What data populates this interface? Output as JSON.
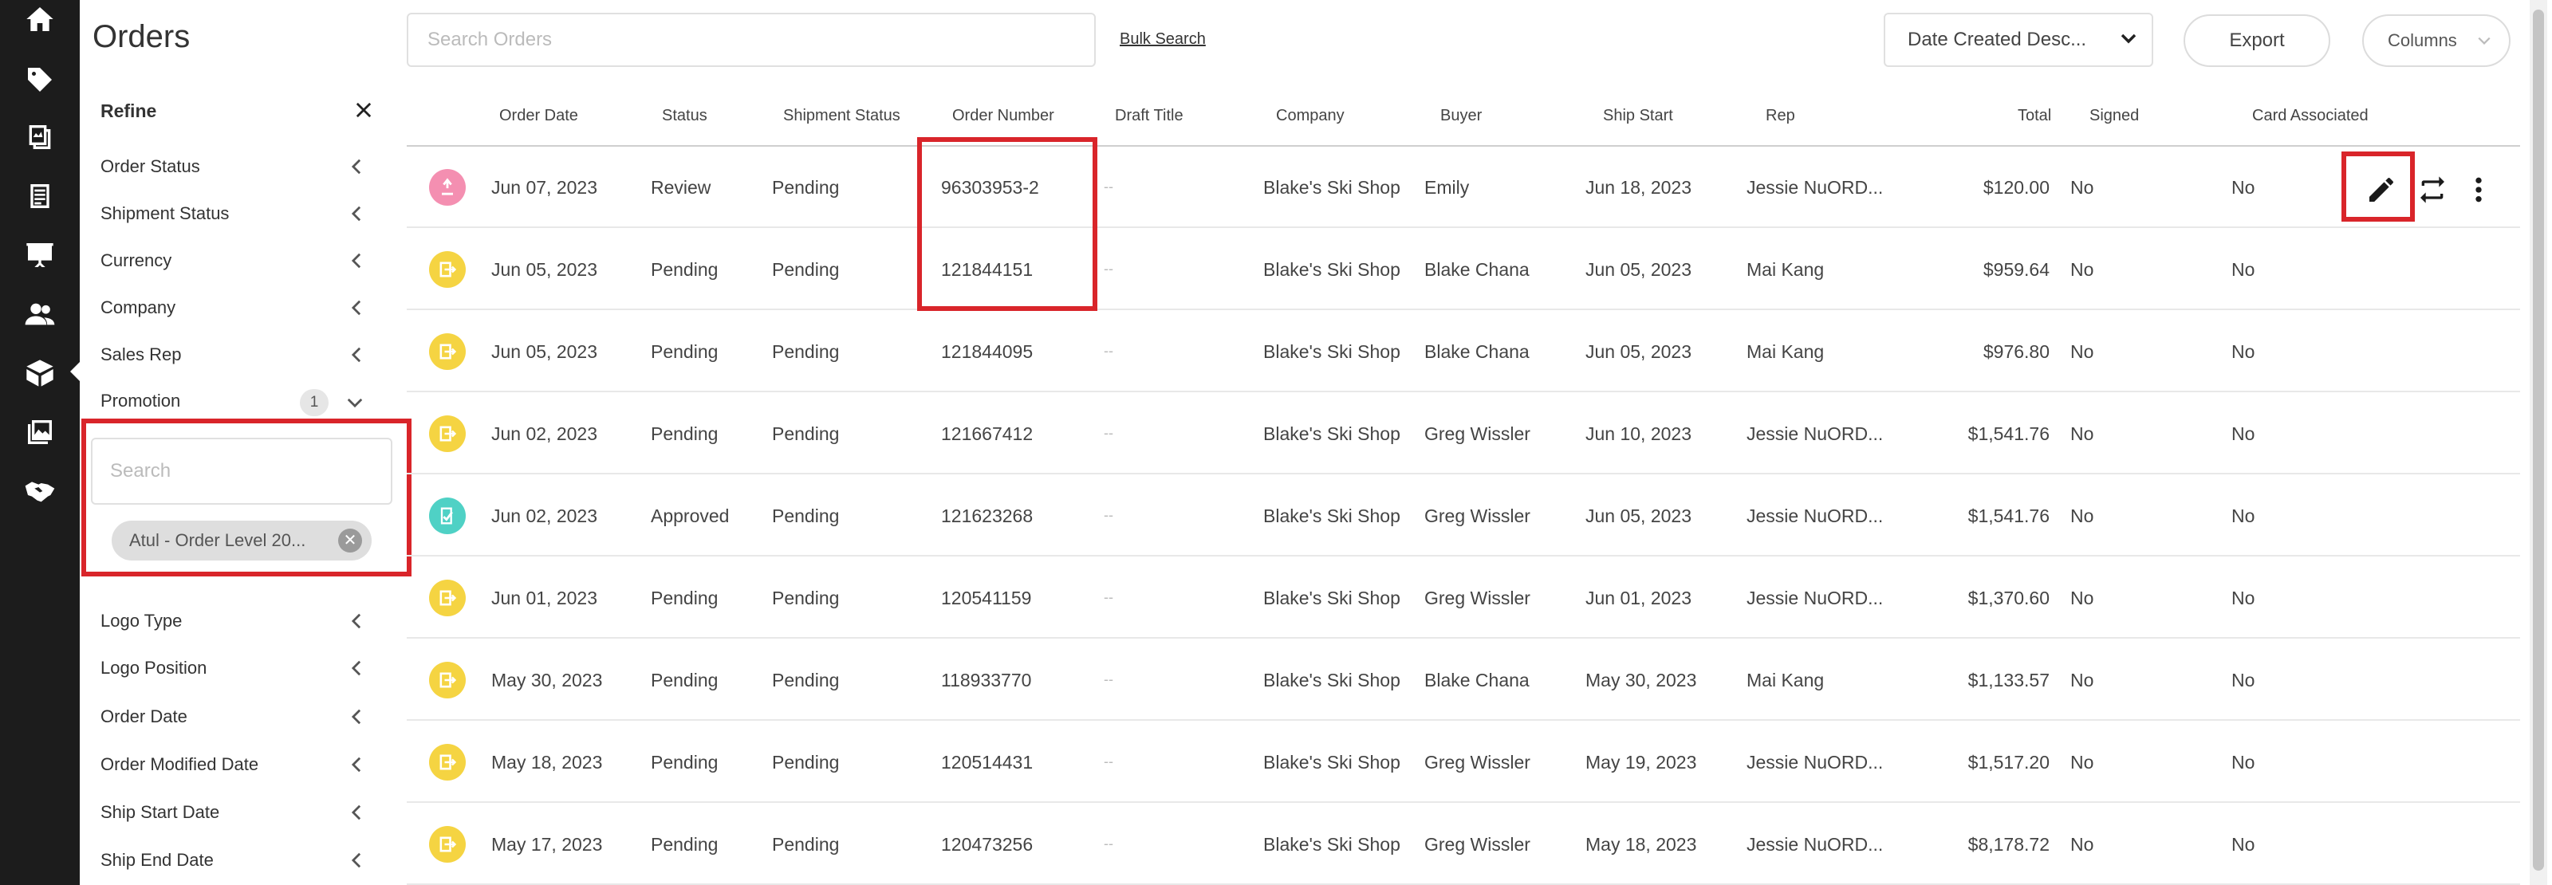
{
  "rail": {
    "icons": [
      "home-icon",
      "tag-icon",
      "catalog-icon",
      "list-icon",
      "presentation-icon",
      "users-icon",
      "box-icon",
      "gallery-icon",
      "handshake-icon"
    ],
    "active_index": 6
  },
  "page": {
    "title": "Orders"
  },
  "refine": {
    "title": "Refine",
    "filters_top": [
      {
        "label": "Order Status"
      },
      {
        "label": "Shipment Status"
      },
      {
        "label": "Currency"
      },
      {
        "label": "Company"
      },
      {
        "label": "Sales Rep"
      }
    ],
    "promotion": {
      "label": "Promotion",
      "count": "1",
      "search_placeholder": "Search",
      "selected_chip": "Atul - Order Level 20..."
    },
    "filters_bottom": [
      {
        "label": "Logo Type"
      },
      {
        "label": "Logo Position"
      },
      {
        "label": "Order Date"
      },
      {
        "label": "Order Modified Date"
      },
      {
        "label": "Ship Start Date"
      },
      {
        "label": "Ship End Date"
      }
    ]
  },
  "toolbar": {
    "search_placeholder": "Search Orders",
    "bulk_search": "Bulk Search",
    "sort_value": "Date Created Desc...",
    "export": "Export",
    "columns": "Columns"
  },
  "table": {
    "columns": [
      "Order Date",
      "Status",
      "Shipment Status",
      "Order Number",
      "Draft Title",
      "Company",
      "Buyer",
      "Ship Start",
      "Rep",
      "Total",
      "Signed",
      "Card Associated"
    ],
    "rows": [
      {
        "status_icon": "review",
        "icon_color": "#f48fb1",
        "order_date": "Jun 07, 2023",
        "status": "Review",
        "shipment_status": "Pending",
        "order_number": "96303953-2",
        "draft_title": "--",
        "company": "Blake's Ski Shop",
        "buyer": "Emily",
        "ship_start": "Jun 18, 2023",
        "rep": "Jessie NuORD...",
        "total": "$120.00",
        "signed": "No",
        "card": "No"
      },
      {
        "status_icon": "pending",
        "icon_color": "#f5d442",
        "order_date": "Jun 05, 2023",
        "status": "Pending",
        "shipment_status": "Pending",
        "order_number": "121844151",
        "draft_title": "--",
        "company": "Blake's Ski Shop",
        "buyer": "Blake Chana",
        "ship_start": "Jun 05, 2023",
        "rep": "Mai Kang",
        "total": "$959.64",
        "signed": "No",
        "card": "No"
      },
      {
        "status_icon": "pending",
        "icon_color": "#f5d442",
        "order_date": "Jun 05, 2023",
        "status": "Pending",
        "shipment_status": "Pending",
        "order_number": "121844095",
        "draft_title": "--",
        "company": "Blake's Ski Shop",
        "buyer": "Blake Chana",
        "ship_start": "Jun 05, 2023",
        "rep": "Mai Kang",
        "total": "$976.80",
        "signed": "No",
        "card": "No"
      },
      {
        "status_icon": "pending",
        "icon_color": "#f5d442",
        "order_date": "Jun 02, 2023",
        "status": "Pending",
        "shipment_status": "Pending",
        "order_number": "121667412",
        "draft_title": "--",
        "company": "Blake's Ski Shop",
        "buyer": "Greg Wissler",
        "ship_start": "Jun 10, 2023",
        "rep": "Jessie NuORD...",
        "total": "$1,541.76",
        "signed": "No",
        "card": "No"
      },
      {
        "status_icon": "approved",
        "icon_color": "#4fd1c5",
        "order_date": "Jun 02, 2023",
        "status": "Approved",
        "shipment_status": "Pending",
        "order_number": "121623268",
        "draft_title": "--",
        "company": "Blake's Ski Shop",
        "buyer": "Greg Wissler",
        "ship_start": "Jun 05, 2023",
        "rep": "Jessie NuORD...",
        "total": "$1,541.76",
        "signed": "No",
        "card": "No"
      },
      {
        "status_icon": "pending",
        "icon_color": "#f5d442",
        "order_date": "Jun 01, 2023",
        "status": "Pending",
        "shipment_status": "Pending",
        "order_number": "120541159",
        "draft_title": "--",
        "company": "Blake's Ski Shop",
        "buyer": "Greg Wissler",
        "ship_start": "Jun 01, 2023",
        "rep": "Jessie NuORD...",
        "total": "$1,370.60",
        "signed": "No",
        "card": "No"
      },
      {
        "status_icon": "pending",
        "icon_color": "#f5d442",
        "order_date": "May 30, 2023",
        "status": "Pending",
        "shipment_status": "Pending",
        "order_number": "118933770",
        "draft_title": "--",
        "company": "Blake's Ski Shop",
        "buyer": "Blake Chana",
        "ship_start": "May 30, 2023",
        "rep": "Mai Kang",
        "total": "$1,133.57",
        "signed": "No",
        "card": "No"
      },
      {
        "status_icon": "pending",
        "icon_color": "#f5d442",
        "order_date": "May 18, 2023",
        "status": "Pending",
        "shipment_status": "Pending",
        "order_number": "120514431",
        "draft_title": "--",
        "company": "Blake's Ski Shop",
        "buyer": "Greg Wissler",
        "ship_start": "May 19, 2023",
        "rep": "Jessie NuORD...",
        "total": "$1,517.20",
        "signed": "No",
        "card": "No"
      },
      {
        "status_icon": "pending",
        "icon_color": "#f5d442",
        "order_date": "May 17, 2023",
        "status": "Pending",
        "shipment_status": "Pending",
        "order_number": "120473256",
        "draft_title": "--",
        "company": "Blake's Ski Shop",
        "buyer": "Greg Wissler",
        "ship_start": "May 18, 2023",
        "rep": "Jessie NuORD...",
        "total": "$8,178.72",
        "signed": "No",
        "card": "No"
      }
    ],
    "row_actions": [
      "edit-icon",
      "sync-icon",
      "more-icon"
    ]
  },
  "highlight_color": "#d9252a"
}
